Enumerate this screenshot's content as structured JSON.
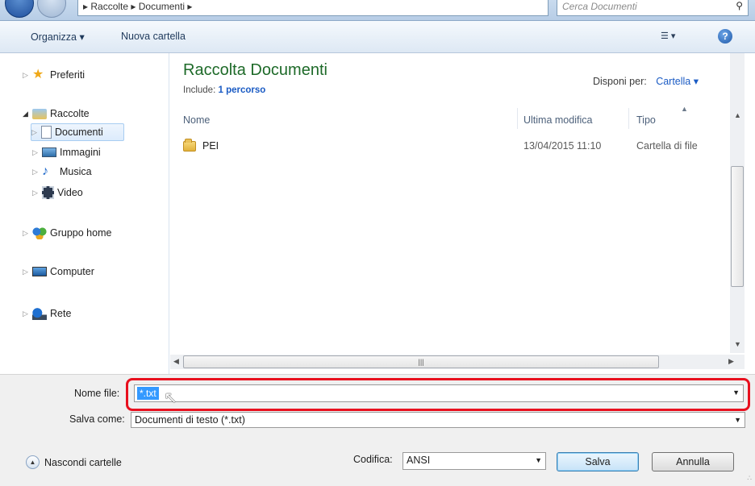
{
  "address": {
    "path": "▸ Raccolte ▸ Documenti ▸"
  },
  "search": {
    "placeholder": "Cerca Documenti"
  },
  "command_bar": {
    "organize": "Organizza ▾",
    "new_folder": "Nuova cartella"
  },
  "sidebar": {
    "favorites": "Preferiti",
    "libraries": "Raccolte",
    "items": [
      {
        "label": "Documenti"
      },
      {
        "label": "Immagini"
      },
      {
        "label": "Musica"
      },
      {
        "label": "Video"
      }
    ],
    "homegroup": "Gruppo home",
    "computer": "Computer",
    "network": "Rete"
  },
  "main": {
    "title": "Raccolta Documenti",
    "includes_label": "Include:",
    "includes_link": "1 percorso",
    "arrange_label": "Disponi per:",
    "arrange_value": "Cartella ▾",
    "columns": [
      "Nome",
      "Ultima modifica",
      "Tipo"
    ],
    "rows": [
      {
        "name": "PEI",
        "modified": "13/04/2015 11:10",
        "type": "Cartella di file"
      }
    ]
  },
  "form": {
    "filename_label": "Nome file:",
    "filename_value": "*.txt",
    "savetype_label": "Salva come:",
    "savetype_value": "Documenti di testo (*.txt)",
    "hide_folders": "Nascondi cartelle",
    "encoding_label": "Codifica:",
    "encoding_value": "ANSI",
    "save": "Salva",
    "cancel": "Annulla"
  },
  "colors": {
    "highlight": "#e8101e",
    "title_green": "#1e6a29",
    "link_blue": "#1a5bc4",
    "selection": "#3399ff"
  }
}
